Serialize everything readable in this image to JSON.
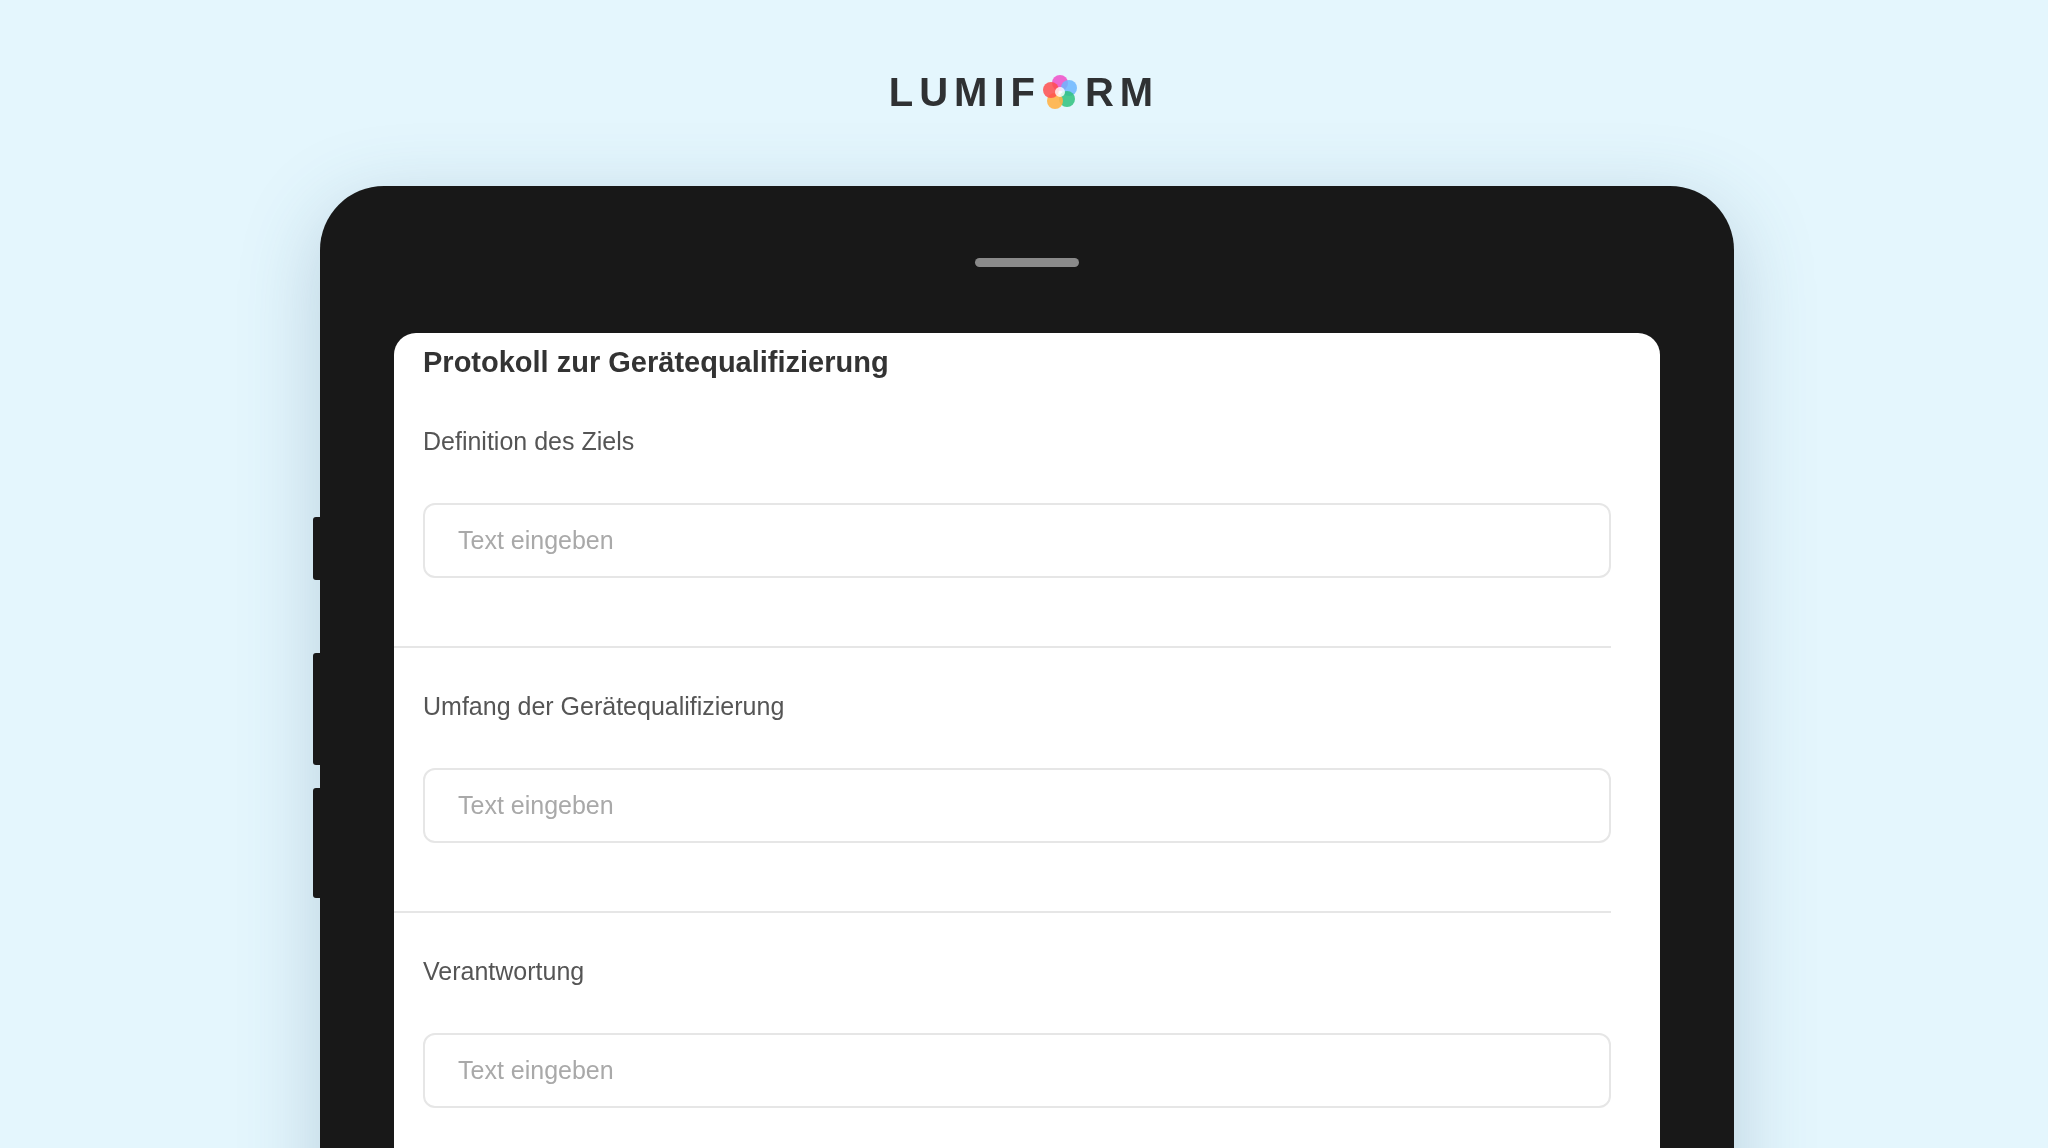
{
  "logo": {
    "before_mark": "LUMIF",
    "after_mark": "RM"
  },
  "form": {
    "title": "Protokoll zur Gerätequalifizierung",
    "fields": [
      {
        "label": "Definition des Ziels",
        "placeholder": "Text eingeben"
      },
      {
        "label": "Umfang der Gerätequalifizierung",
        "placeholder": "Text eingeben"
      },
      {
        "label": "Verantwortung",
        "placeholder": "Text eingeben"
      }
    ]
  }
}
